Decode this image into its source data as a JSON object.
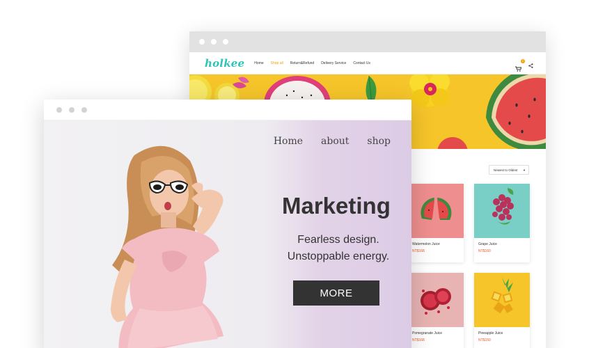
{
  "back_window": {
    "logo": "holkee",
    "nav": [
      {
        "label": "Home",
        "active": false
      },
      {
        "label": "Shop all",
        "active": true
      },
      {
        "label": "Return&Refund",
        "active": false
      },
      {
        "label": "Delivery Service",
        "active": false
      },
      {
        "label": "Contact Us",
        "active": false
      }
    ],
    "cart_count": "0",
    "sort": {
      "selected": "Newest to Oldest"
    },
    "products": [
      {
        "name": "Watermelon Juice",
        "price": "NT$168"
      },
      {
        "name": "Grape Juice",
        "price": "NT$160"
      },
      {
        "name": "Pomegranate Juice",
        "price": "NT$168"
      },
      {
        "name": "Pineapple Juice",
        "price": "NT$150"
      }
    ],
    "colors": {
      "accent": "#2ec4b6",
      "active_nav": "#f0a202",
      "banner": "#f6c52a",
      "price": "#e05a2b"
    }
  },
  "front_window": {
    "nav": [
      "Home",
      "about",
      "shop"
    ],
    "title": "Marketing",
    "subtitle_line1": "Fearless design.",
    "subtitle_line2": "Unstoppable energy.",
    "button_label": "MORE",
    "colors": {
      "button": "#333333",
      "gradient_end": "#dccbe5"
    }
  },
  "icons": [
    "cart-icon",
    "share-icon"
  ]
}
